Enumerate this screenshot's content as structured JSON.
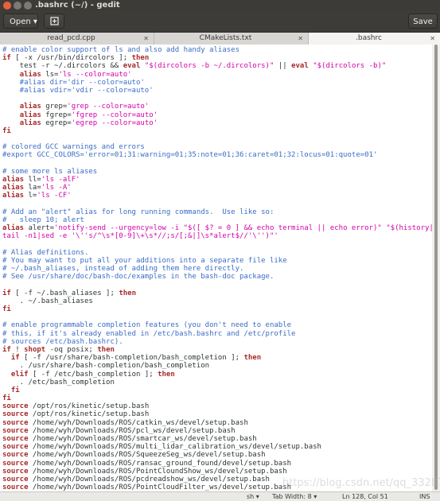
{
  "window": {
    "title": ".bashrc (~/) - gedit"
  },
  "header": {
    "open_label": "Open ▾",
    "save_label": "Save"
  },
  "tabs": [
    {
      "label": "read_pcd.cpp"
    },
    {
      "label": "CMakeLists.txt"
    },
    {
      "label": ".bashrc"
    }
  ],
  "code_lines": [
    [
      [
        "c",
        "# enable color support of ls and also add handy aliases"
      ]
    ],
    [
      [
        "k",
        "if"
      ],
      [
        "t",
        " [ -x /usr/bin/dircolors ]; "
      ],
      [
        "k",
        "then"
      ]
    ],
    [
      [
        "t",
        "    test -r ~/.dircolors && "
      ],
      [
        "k",
        "eval"
      ],
      [
        "t",
        " "
      ],
      [
        "s",
        "\"$(dircolors -b ~/.dircolors)\""
      ],
      [
        "t",
        " || "
      ],
      [
        "k",
        "eval"
      ],
      [
        "t",
        " "
      ],
      [
        "s",
        "\"$(dircolors -b)\""
      ]
    ],
    [
      [
        "t",
        "    "
      ],
      [
        "k",
        "alias"
      ],
      [
        "t",
        " ls="
      ],
      [
        "s",
        "'ls --color=auto'"
      ]
    ],
    [
      [
        "c",
        "    #alias dir='dir --color=auto'"
      ]
    ],
    [
      [
        "c",
        "    #alias vdir='vdir --color=auto'"
      ]
    ],
    [
      [
        "t",
        ""
      ]
    ],
    [
      [
        "t",
        "    "
      ],
      [
        "k",
        "alias"
      ],
      [
        "t",
        " grep="
      ],
      [
        "s",
        "'grep --color=auto'"
      ]
    ],
    [
      [
        "t",
        "    "
      ],
      [
        "k",
        "alias"
      ],
      [
        "t",
        " fgrep="
      ],
      [
        "s",
        "'fgrep --color=auto'"
      ]
    ],
    [
      [
        "t",
        "    "
      ],
      [
        "k",
        "alias"
      ],
      [
        "t",
        " egrep="
      ],
      [
        "s",
        "'egrep --color=auto'"
      ]
    ],
    [
      [
        "k",
        "fi"
      ]
    ],
    [
      [
        "t",
        ""
      ]
    ],
    [
      [
        "c",
        "# colored GCC warnings and errors"
      ]
    ],
    [
      [
        "c",
        "#export GCC_COLORS='error=01;31:warning=01;35:note=01;36:caret=01;32:locus=01:quote=01'"
      ]
    ],
    [
      [
        "t",
        ""
      ]
    ],
    [
      [
        "c",
        "# some more ls aliases"
      ]
    ],
    [
      [
        "k",
        "alias"
      ],
      [
        "t",
        " ll="
      ],
      [
        "s",
        "'ls -alF'"
      ]
    ],
    [
      [
        "k",
        "alias"
      ],
      [
        "t",
        " la="
      ],
      [
        "s",
        "'ls -A'"
      ]
    ],
    [
      [
        "k",
        "alias"
      ],
      [
        "t",
        " l="
      ],
      [
        "s",
        "'ls -CF'"
      ]
    ],
    [
      [
        "t",
        ""
      ]
    ],
    [
      [
        "c",
        "# Add an \"alert\" alias for long running commands.  Use like so:"
      ]
    ],
    [
      [
        "c",
        "#   sleep 10; alert"
      ]
    ],
    [
      [
        "k",
        "alias"
      ],
      [
        "t",
        " alert="
      ],
      [
        "s",
        "'notify-send --urgency=low -i \"$([ $? = 0 ] && echo terminal || echo error)\" \"$(history|"
      ]
    ],
    [
      [
        "s",
        "tail -n1|sed -e '\\''s/^\\s*[0-9]\\+\\s*//;s/[;&|]\\s*alert$//'\\'')\"'"
      ]
    ],
    [
      [
        "t",
        ""
      ]
    ],
    [
      [
        "c",
        "# Alias definitions."
      ]
    ],
    [
      [
        "c",
        "# You may want to put all your additions into a separate file like"
      ]
    ],
    [
      [
        "c",
        "# ~/.bash_aliases, instead of adding them here directly."
      ]
    ],
    [
      [
        "c",
        "# See /usr/share/doc/bash-doc/examples in the bash-doc package."
      ]
    ],
    [
      [
        "t",
        ""
      ]
    ],
    [
      [
        "k",
        "if"
      ],
      [
        "t",
        " [ -f ~/.bash_aliases ]; "
      ],
      [
        "k",
        "then"
      ]
    ],
    [
      [
        "t",
        "    . ~/.bash_aliases"
      ]
    ],
    [
      [
        "k",
        "fi"
      ]
    ],
    [
      [
        "t",
        ""
      ]
    ],
    [
      [
        "c",
        "# enable programmable completion features (you don't need to enable"
      ]
    ],
    [
      [
        "c",
        "# this, if it's already enabled in /etc/bash.bashrc and /etc/profile"
      ]
    ],
    [
      [
        "c",
        "# sources /etc/bash.bashrc)."
      ]
    ],
    [
      [
        "k",
        "if"
      ],
      [
        "t",
        " ! "
      ],
      [
        "k",
        "shopt"
      ],
      [
        "t",
        " -oq posix; "
      ],
      [
        "k",
        "then"
      ]
    ],
    [
      [
        "t",
        "  "
      ],
      [
        "k",
        "if"
      ],
      [
        "t",
        " [ -f /usr/share/bash-completion/bash_completion ]; "
      ],
      [
        "k",
        "then"
      ]
    ],
    [
      [
        "t",
        "    . /usr/share/bash-completion/bash_completion"
      ]
    ],
    [
      [
        "t",
        "  "
      ],
      [
        "k",
        "elif"
      ],
      [
        "t",
        " [ -f /etc/bash_completion ]; "
      ],
      [
        "k",
        "then"
      ]
    ],
    [
      [
        "t",
        "    . /etc/bash_completion"
      ]
    ],
    [
      [
        "t",
        "  "
      ],
      [
        "k",
        "fi"
      ]
    ],
    [
      [
        "k",
        "fi"
      ]
    ],
    [
      [
        "k",
        "source"
      ],
      [
        "t",
        " /opt/ros/kinetic/setup.bash"
      ]
    ],
    [
      [
        "k",
        "source"
      ],
      [
        "t",
        " /opt/ros/kinetic/setup.bash"
      ]
    ],
    [
      [
        "k",
        "source"
      ],
      [
        "t",
        " /home/wyh/Downloads/ROS/catkin_ws/devel/setup.bash"
      ]
    ],
    [
      [
        "k",
        "source"
      ],
      [
        "t",
        " /home/wyh/Downloads/ROS/pcl_ws/devel/setup.bash"
      ]
    ],
    [
      [
        "k",
        "source"
      ],
      [
        "t",
        " /home/wyh/Downloads/ROS/smartcar_ws/devel/setup.bash"
      ]
    ],
    [
      [
        "k",
        "source"
      ],
      [
        "t",
        " /home/wyh/Downloads/ROS/multi_lidar_calibration_ws/devel/setup.bash"
      ]
    ],
    [
      [
        "k",
        "source"
      ],
      [
        "t",
        " /home/wyh/Downloads/ROS/SqueezeSeg_ws/devel/setup.bash"
      ]
    ],
    [
      [
        "k",
        "source"
      ],
      [
        "t",
        " /home/wyh/Downloads/ROS/ransac_ground_found/devel/setup.bash"
      ]
    ],
    [
      [
        "k",
        "source"
      ],
      [
        "t",
        " /home/wyh/Downloads/ROS/PointCloundShow_ws/devel/setup.bash"
      ]
    ],
    [
      [
        "k",
        "source"
      ],
      [
        "t",
        " /home/wyh/Downloads/ROS/pcdreadshow_ws/devel/setup.bash"
      ]
    ],
    [
      [
        "k",
        "source"
      ],
      [
        "t",
        " /home/wyh/Downloads/ROS/PointCloudFilter_ws/devel/setup.bash"
      ]
    ]
  ],
  "status": {
    "language": "sh ▾",
    "tab_width": "Tab Width: 8 ▾",
    "position": "Ln 128, Col 51",
    "insert_mode": "INS"
  },
  "watermark": "https://blog.csdn.net/qq_33287871",
  "colors": {
    "comment": "#3b6dc5",
    "keyword": "#a52a2a",
    "string": "#d300a8"
  }
}
